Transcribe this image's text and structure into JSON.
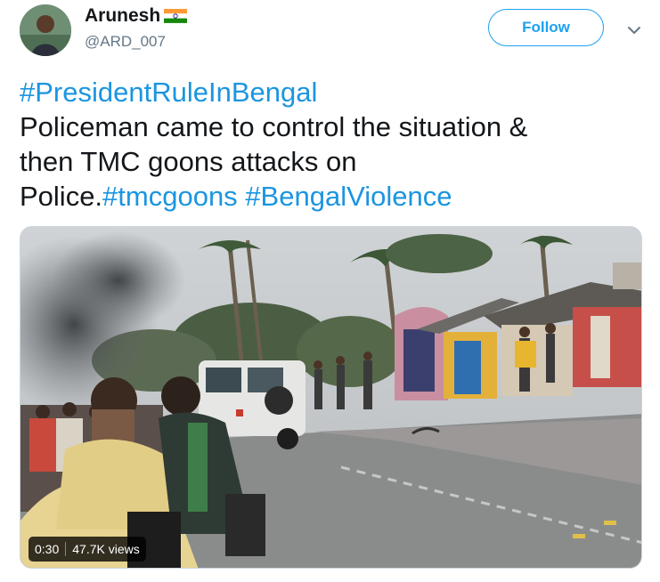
{
  "user": {
    "display_name": "Arunesh",
    "handle": "@ARD_007",
    "avatar_icon": "user-avatar",
    "badge_icon": "india-flag-icon"
  },
  "actions": {
    "follow_label": "Follow",
    "menu_icon": "chevron-down-icon"
  },
  "tweet": {
    "hashtag_line": "#PresidentRuleInBengal",
    "body_line_1": "Policeman came to control the situation &",
    "body_line_2": "then TMC goons attacks on",
    "body_line_3_prefix": "Police.",
    "hashtag_tmcgoons": "#tmcgoons",
    "hashtag_bengalviolence": "#BengalViolence"
  },
  "video": {
    "duration": "0:30",
    "views": "47.7K views"
  },
  "colors": {
    "brand_blue": "#1da1f2",
    "hashtag_blue": "#1b95e0",
    "text": "#14171a",
    "secondary": "#657786"
  }
}
